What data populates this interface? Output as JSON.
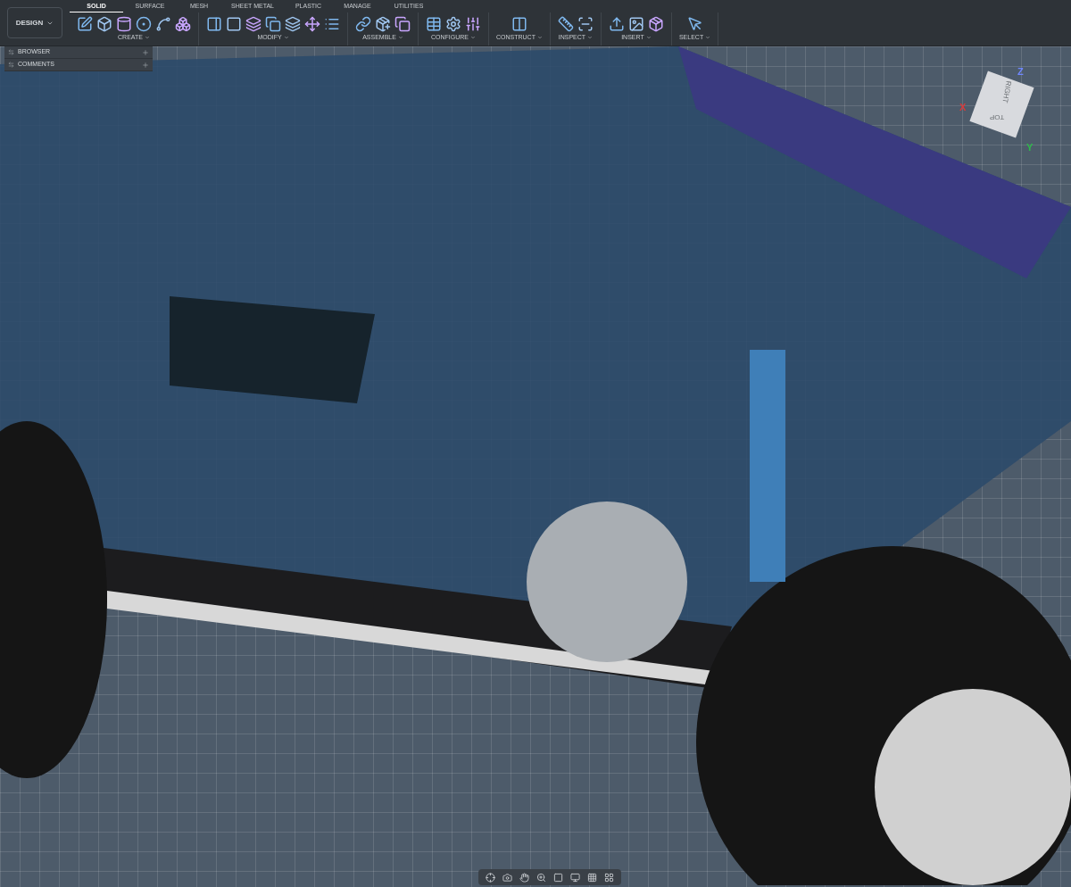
{
  "workspace": {
    "label": "DESIGN"
  },
  "tabs": [
    {
      "label": "SOLID",
      "selected": true
    },
    {
      "label": "SURFACE",
      "selected": false
    },
    {
      "label": "MESH",
      "selected": false
    },
    {
      "label": "SHEET METAL",
      "selected": false
    },
    {
      "label": "PLASTIC",
      "selected": false
    },
    {
      "label": "MANAGE",
      "selected": false
    },
    {
      "label": "UTILITIES",
      "selected": false
    }
  ],
  "groups": [
    {
      "label": "CREATE"
    },
    {
      "label": "MODIFY"
    },
    {
      "label": "ASSEMBLE"
    },
    {
      "label": "CONFIGURE"
    },
    {
      "label": "CONSTRUCT"
    },
    {
      "label": "INSPECT"
    },
    {
      "label": "INSERT"
    },
    {
      "label": "SELECT"
    }
  ],
  "panels": [
    {
      "label": "BROWSER"
    },
    {
      "label": "COMMENTS"
    }
  ],
  "view_cube": {
    "faces": [
      "RIGHT",
      "TOP"
    ],
    "axes": [
      {
        "label": "Z",
        "color": "#7088ff"
      },
      {
        "label": "X",
        "color": "#d83a3a"
      },
      {
        "label": "Y",
        "color": "#2fb84a"
      }
    ]
  }
}
